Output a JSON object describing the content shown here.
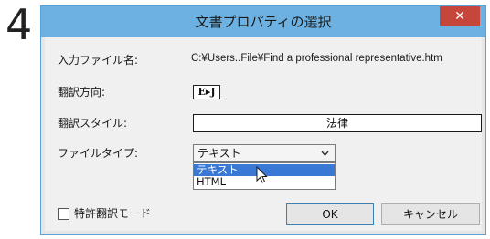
{
  "step_number": "4",
  "dialog": {
    "title": "文書プロパティの選択",
    "close_icon": "close-icon",
    "close_glyph": "✕"
  },
  "fields": {
    "input_file_label": "入力ファイル名:",
    "input_file_value": "C:¥Users..File¥Find a professional representative.htm",
    "direction_label": "翻訳方向:",
    "direction_value": "E▸J",
    "style_label": "翻訳スタイル:",
    "style_value": "法律",
    "filetype_label": "ファイルタイプ:",
    "filetype_selected": "テキスト",
    "filetype_options": [
      "テキスト",
      "HTML"
    ]
  },
  "patent_mode_label": "特許翻訳モード",
  "buttons": {
    "ok_label": "OK",
    "cancel_label": "キャンセル"
  },
  "colors": {
    "titlebar": "#6cb1e2",
    "close_button": "#c7463c",
    "selection": "#3a78d6"
  }
}
